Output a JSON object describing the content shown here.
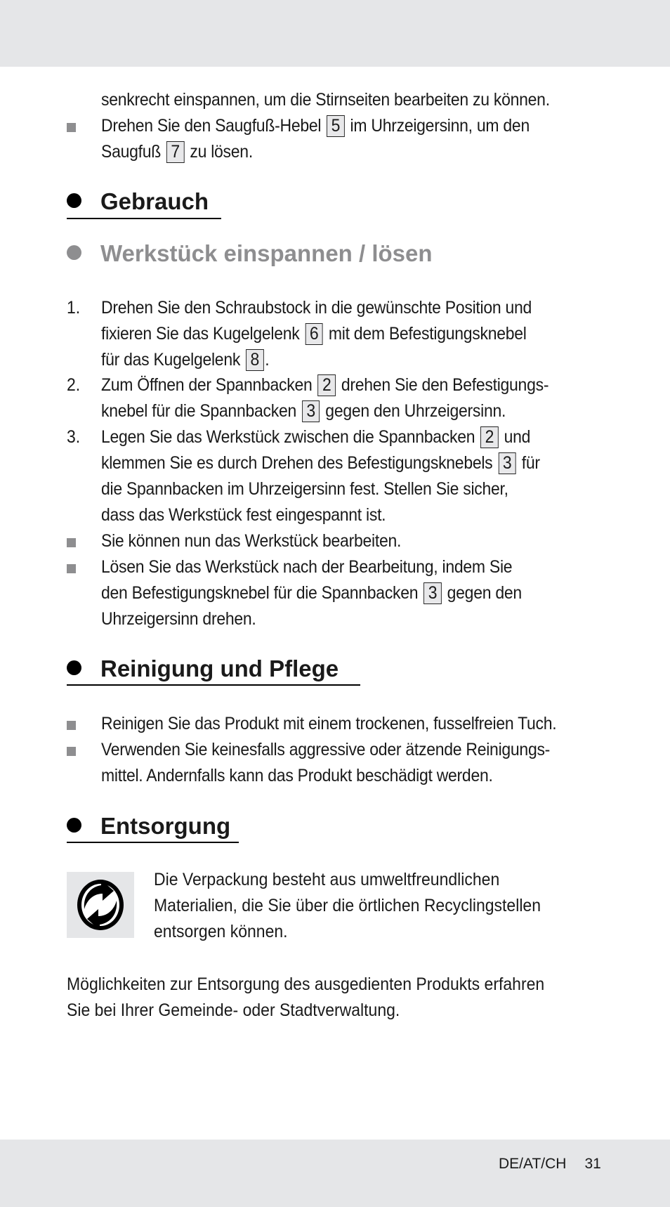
{
  "intro": {
    "line1": "senkrecht einspannen, um die Stirnseiten bearbeiten zu können.",
    "bullet": {
      "pre": "Drehen Sie den Saugfuß-Hebel",
      "ref1": "5",
      "mid": "im Uhrzeigersinn, um den",
      "line2_pre": "Saugfuß",
      "ref2": "7",
      "line2_post": "zu lösen."
    }
  },
  "headings": {
    "gebrauch": "Gebrauch",
    "werkstueck": "Werkstück einspannen / lösen",
    "reinigung": "Reinigung und Pflege",
    "entsorgung": "Entsorgung"
  },
  "steps": [
    {
      "num": "1.",
      "l1": "Drehen Sie den Schraubstock in die gewünschte Position und",
      "l2_pre": "fixieren Sie das Kugelgelenk",
      "l2_ref": "6",
      "l2_post": "mit dem Befestigungsknebel",
      "l3_pre": "für das Kugelgelenk",
      "l3_ref": "8",
      "l3_post": "."
    },
    {
      "num": "2.",
      "l1_pre": "Zum Öffnen der Spannbacken",
      "l1_ref": "2",
      "l1_post": "drehen Sie den Befestigungs-",
      "l2_pre": "knebel für die Spannbacken",
      "l2_ref": "3",
      "l2_post": "gegen den Uhrzeigersinn."
    },
    {
      "num": "3.",
      "l1_pre": "Legen Sie das Werkstück zwischen die Spannbacken",
      "l1_ref": "2",
      "l1_post": "und",
      "l2_pre": "klemmen Sie es durch Drehen des Befestigungsknebels",
      "l2_ref": "3",
      "l2_post": "für",
      "l3": "die Spannbacken im Uhrzeigersinn fest. Stellen Sie sicher,",
      "l4": "dass das Werkstück fest eingespannt ist."
    }
  ],
  "use_bullets": {
    "b1": "Sie können nun das Werkstück bearbeiten.",
    "b2_l1": "Lösen Sie das Werkstück nach der Bearbeitung, indem Sie",
    "b2_l2_pre": "den Befestigungsknebel für die Spannbacken",
    "b2_l2_ref": "3",
    "b2_l2_post": "gegen den",
    "b2_l3": "Uhrzeigersinn drehen."
  },
  "cleaning": {
    "b1": "Reinigen Sie das Produkt mit einem trockenen, fusselfreien Tuch.",
    "b2_l1": "Verwenden Sie keinesfalls aggressive oder ätzende Reinigungs-",
    "b2_l2": "mittel. Andernfalls kann das Produkt beschädigt werden."
  },
  "disposal": {
    "logo_icon": "green-dot-recycling-icon",
    "l1": "Die Verpackung besteht aus umweltfreundlichen",
    "l2": "Materialien, die Sie über die örtlichen Recyclingstellen",
    "l3": "entsorgen können.",
    "p1": "Möglichkeiten zur Entsorgung des ausgedienten Produkts erfahren",
    "p2": "Sie bei Ihrer Gemeinde- oder Stadtverwaltung."
  },
  "footer": {
    "region": "DE/AT/CH",
    "page": "31"
  }
}
